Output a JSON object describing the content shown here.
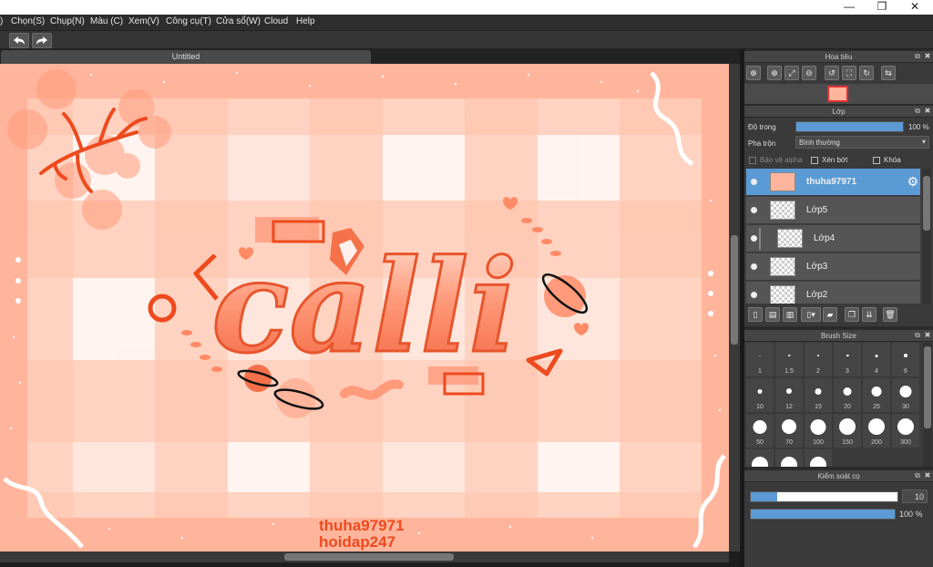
{
  "window": {
    "minimize": "—",
    "maximize": "❐",
    "close": "✕"
  },
  "menu": [
    ")",
    "Chọn(S)",
    "Chụp(N)",
    "Màu (C)",
    "Xem(V)",
    "Công cụ(T)",
    "Cửa sổ(W)",
    "Cloud",
    "Help"
  ],
  "canvas": {
    "tab_title": "Untitled",
    "artwork_text": "calli",
    "watermark_line1": "thuha97971",
    "watermark_line2": "hoidap247"
  },
  "navigator": {
    "title": "Hoa tiêu"
  },
  "layer_panel": {
    "title": "Lớp",
    "opacity_label": "Độ trong",
    "opacity_value": "100 %",
    "opacity_fraction": 1.0,
    "blend_label": "Pha trộn",
    "blend_value": "Bình thường",
    "protect_alpha": "Bảo vệ alpha",
    "clipping": "Xén bớt",
    "lock": "Khóa",
    "layers": [
      {
        "name": "thuha97971",
        "active": true
      },
      {
        "name": "Lớp5",
        "active": false
      },
      {
        "name": "Lớp4",
        "active": false
      },
      {
        "name": "Lớp3",
        "active": false
      },
      {
        "name": "Lớp2",
        "active": false
      }
    ]
  },
  "brush_size": {
    "title": "Brush Size",
    "sizes": [
      "1",
      "1.5",
      "2",
      "3",
      "4",
      "6",
      "10",
      "12",
      "15",
      "20",
      "25",
      "30",
      "50",
      "70",
      "100",
      "150",
      "200",
      "300",
      "",
      "",
      ""
    ]
  },
  "brush_control": {
    "title": "Kiểm soát cọ",
    "size_value": "10",
    "size_fraction": 0.18,
    "opacity_value": "100 %",
    "opacity_fraction": 1.0
  },
  "colors": {
    "accent": "#5b9bd5",
    "art_orange": "#f4714a",
    "art_peach": "#ffb49a"
  }
}
